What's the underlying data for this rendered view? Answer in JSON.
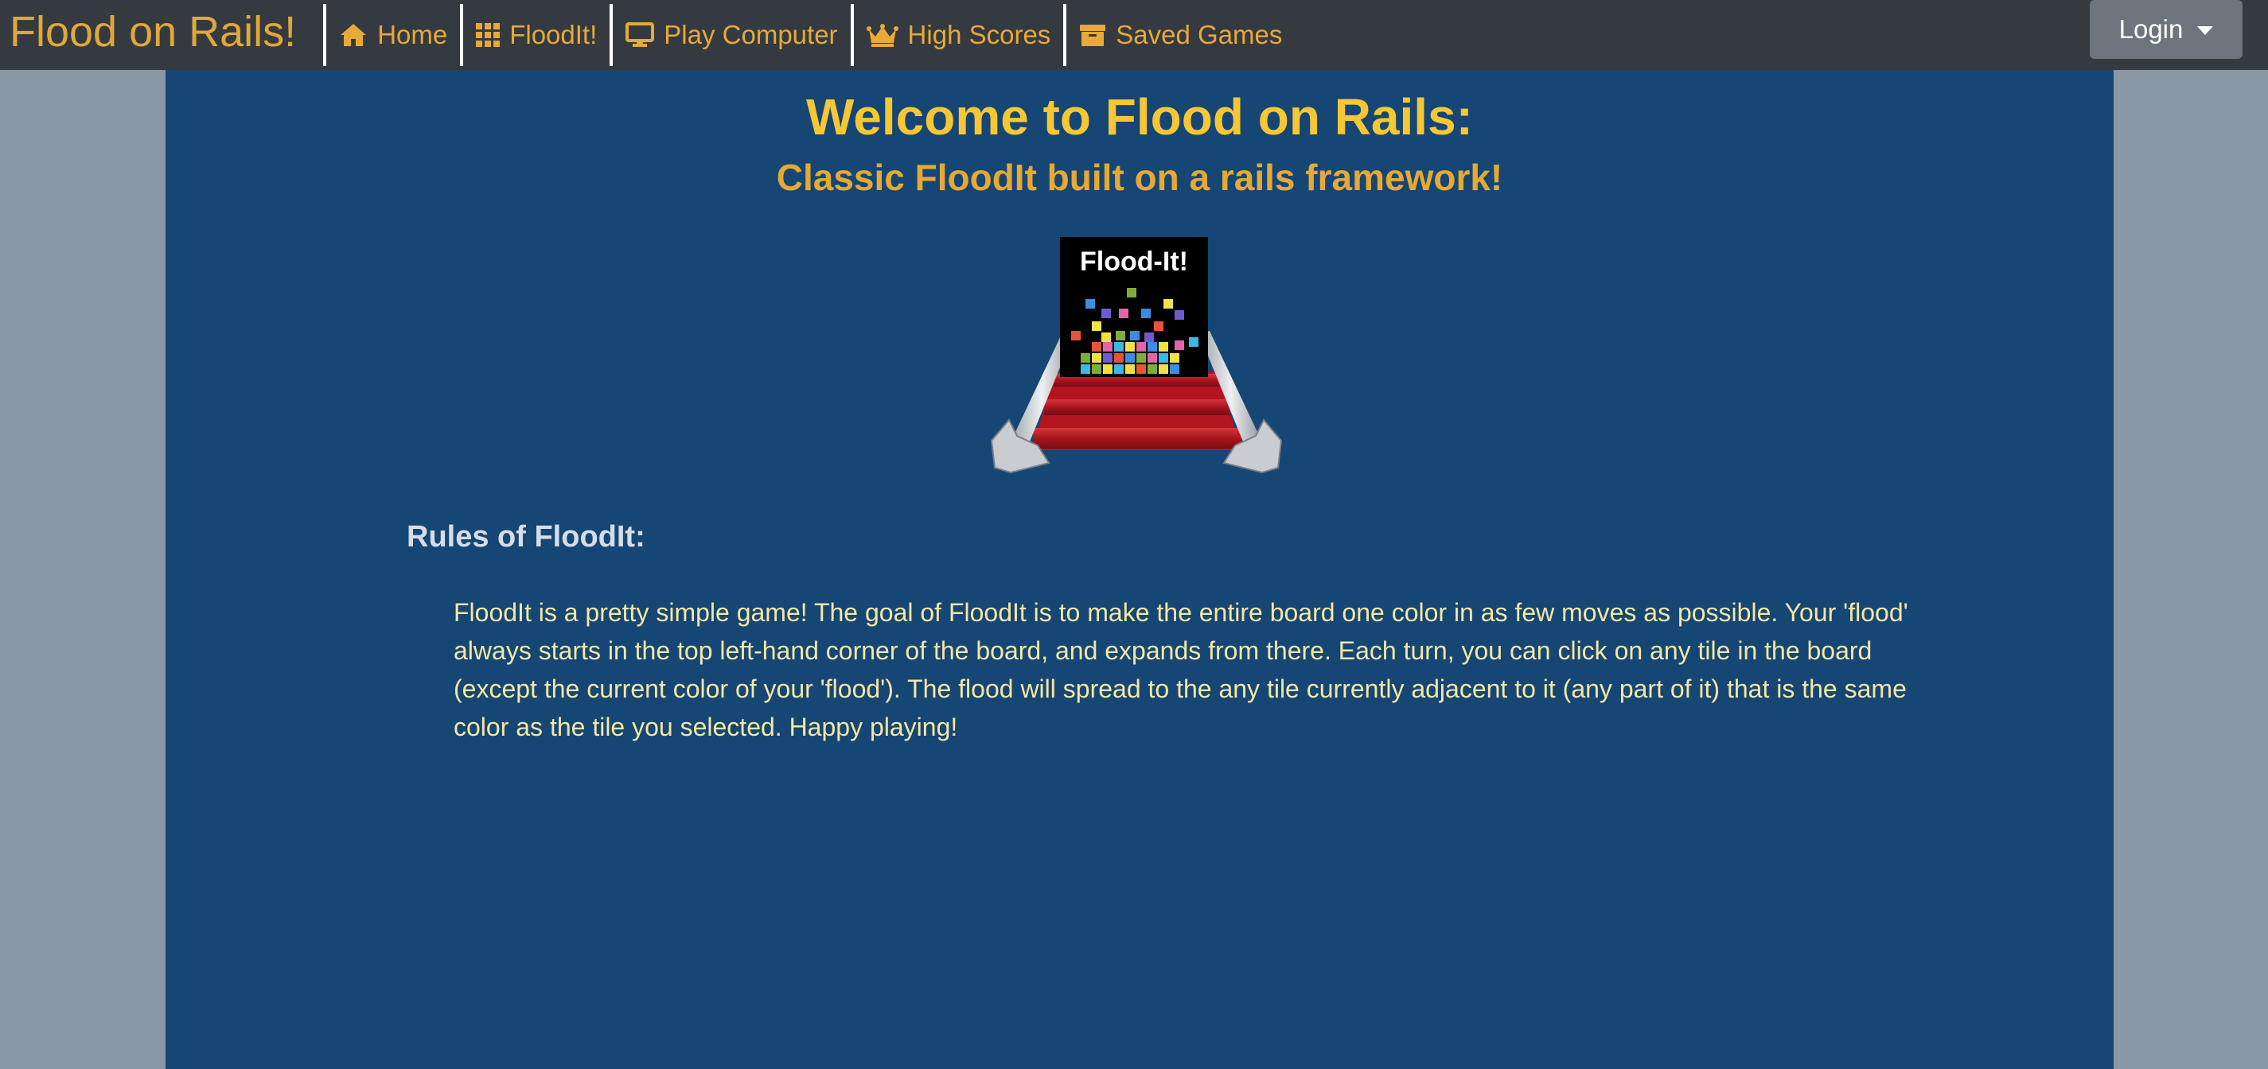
{
  "navbar": {
    "brand": "Flood on Rails!",
    "items": [
      {
        "label": "Home",
        "icon": "home-icon"
      },
      {
        "label": "FloodIt!",
        "icon": "grid-icon"
      },
      {
        "label": "Play Computer",
        "icon": "desktop-icon"
      },
      {
        "label": "High Scores",
        "icon": "crown-icon"
      },
      {
        "label": "Saved Games",
        "icon": "archive-icon"
      }
    ],
    "login_label": "Login"
  },
  "main": {
    "title": "Welcome to Flood on Rails:",
    "subtitle": "Classic FloodIt built on a rails framework!",
    "logo_text": "Flood-It!",
    "rules_heading": "Rules of FloodIt:",
    "rules_text": "FloodIt is a pretty simple game! The goal of FloodIt is to make the entire board one color in as few moves as possible. Your 'flood' always starts in the top left-hand corner of the board, and expands from there. Each turn, you can click on any tile in the board (except the current color of your 'flood'). The flood will spread to the any tile currently adjacent to it (any part of it) that is the same color as the tile you selected. Happy playing!"
  },
  "colors": {
    "navbar_bg": "#353a40",
    "brand": "#e0a83a",
    "nav_link": "#e7a938",
    "page_bg": "#8a97a5",
    "main_bg": "#164674",
    "title": "#f6c735",
    "subtitle": "#e5a936",
    "rules_heading": "#d5dde8",
    "rules_text": "#f4e7a5",
    "login_bg": "#6c757d"
  }
}
